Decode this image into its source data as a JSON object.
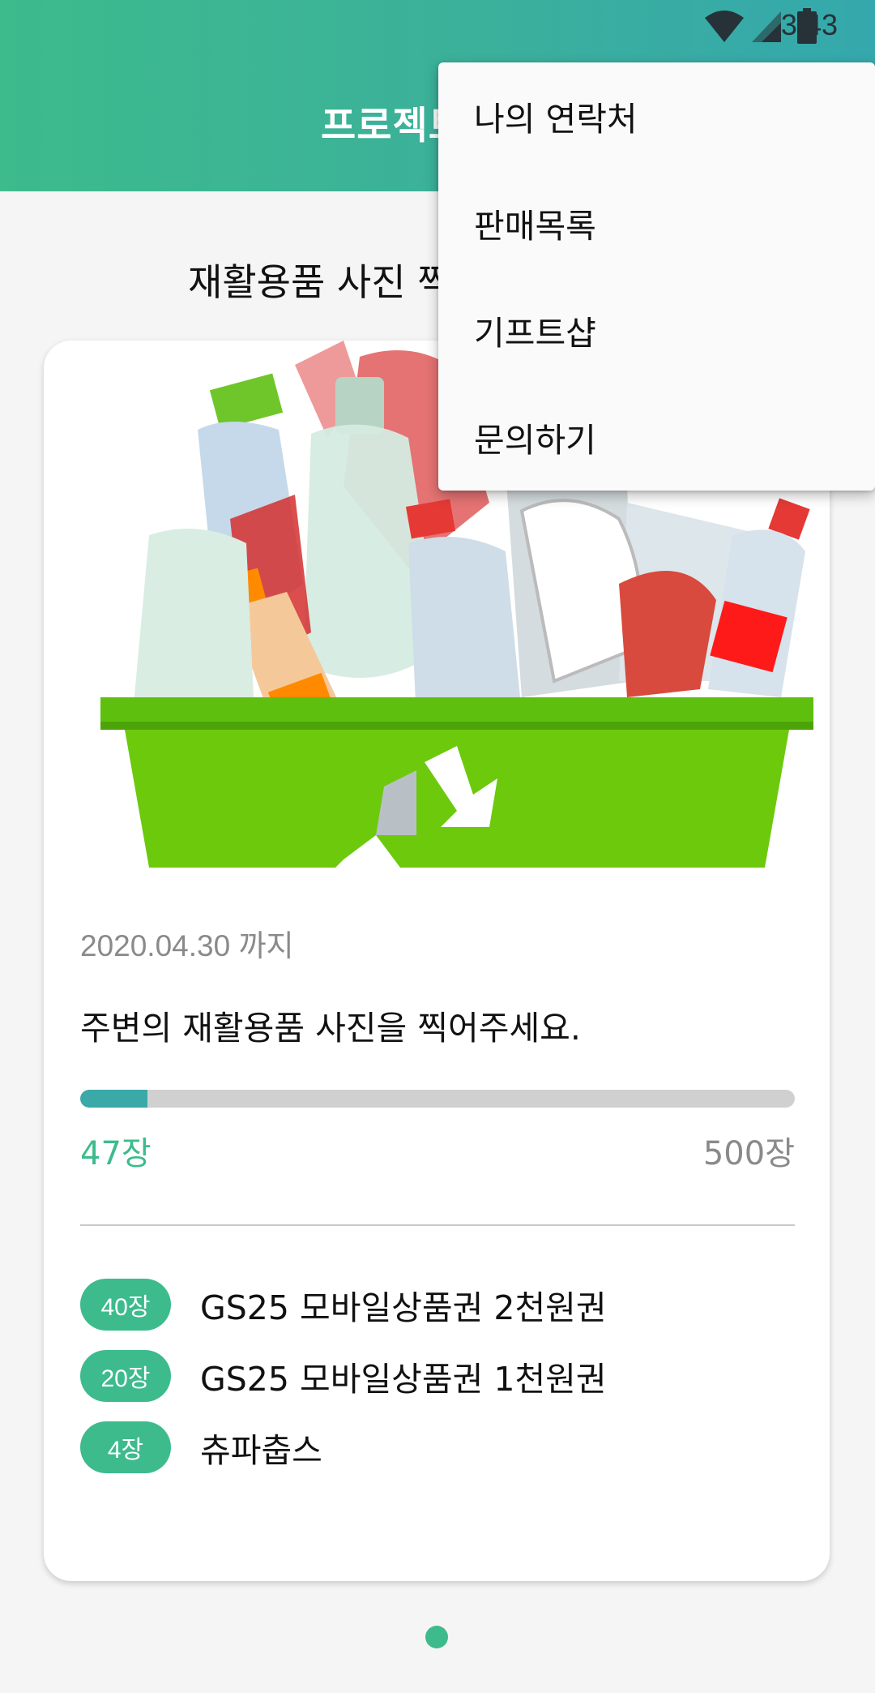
{
  "status_bar": {
    "time": "3:43",
    "icons": [
      "wifi-icon",
      "cell-signal-icon",
      "battery-icon"
    ]
  },
  "header": {
    "title": "프로젝트"
  },
  "subtitle": "재활용품 사진 찍",
  "card": {
    "illustration": "recycling-basket-illustration",
    "deadline": "2020.04.30 까지",
    "description": "주변의 재활용품 사진을 찍어주세요.",
    "progress": {
      "current": 47,
      "max": 500,
      "current_label": "47장",
      "max_label": "500장"
    },
    "rewards": [
      {
        "badge": "40장",
        "label": "GS25 모바일상품권 2천원권"
      },
      {
        "badge": "20장",
        "label": "GS25 모바일상품권 1천원권"
      },
      {
        "badge": "4장",
        "label": "츄파춥스"
      }
    ]
  },
  "pager": {
    "pages": 1,
    "active": 0
  },
  "menu": {
    "items": [
      "나의 연락처",
      "판매목록",
      "기프트샵",
      "문의하기"
    ]
  },
  "colors": {
    "accent": "#3dbb8c",
    "progress": "#3aa9a8",
    "header_end": "#35a8ad"
  }
}
